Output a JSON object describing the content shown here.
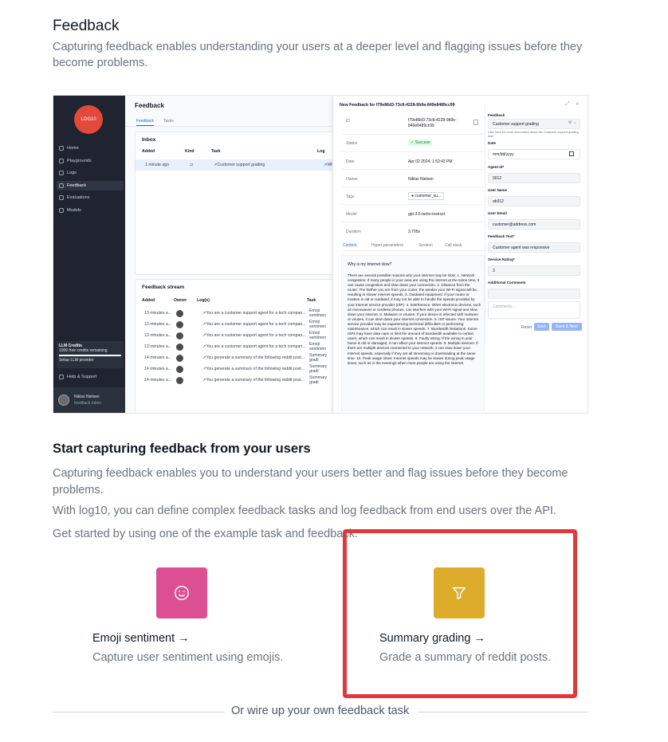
{
  "header": {
    "title": "Feedback",
    "subtitle": "Capturing feedback enables understanding your users at a deeper level and flagging issues before they become problems."
  },
  "preview": {
    "sidebar": {
      "logo_text": "LOG10",
      "items": [
        {
          "label": "Home",
          "active": false
        },
        {
          "label": "Playgrounds",
          "active": false
        },
        {
          "label": "Logs",
          "active": false
        },
        {
          "label": "Feedback",
          "active": true
        },
        {
          "label": "Evaluations",
          "active": false
        },
        {
          "label": "Models",
          "active": false
        }
      ],
      "credits_title": "LLM Credits",
      "credits_sub": "1000 free credits remaining",
      "credits_link": "Setup LLM provider",
      "help": "Help & Support",
      "user_name": "Niklas Nielsen",
      "user_org": "feedback-inbox"
    },
    "main": {
      "title": "Feedback",
      "tabs": [
        "Feedback",
        "Tasks"
      ],
      "inbox_title": "Inbox",
      "inbox_cols": [
        "Added",
        "Kind",
        "Task",
        "Log"
      ],
      "inbox_row": {
        "added": "1 minute ago",
        "task": "↗Customer support grading",
        "log": "↗Why"
      },
      "stream_title": "Feedback stream",
      "stream_cols": [
        "Added",
        "Owner",
        "Log(s)",
        "Task"
      ],
      "stream_rows": [
        {
          "added": "13 minutes a...",
          "log": "↗You are a customer support agent for a tech compan...",
          "task": "Emoji sentimen"
        },
        {
          "added": "13 minutes a...",
          "log": "↗You are a customer support agent for a tech compan...",
          "task": "Emoji sentimen"
        },
        {
          "added": "13 minutes a...",
          "log": "↗You are a customer support agent for a tech compan...",
          "task": "Emoji sentimen"
        },
        {
          "added": "13 minutes a...",
          "log": "↗You are a customer support agent for a tech compan...",
          "task": "Emoji sentimen"
        },
        {
          "added": "14 minutes a...",
          "log": "↗You generate a summary of the following reddit post...",
          "task": "Summary gradi"
        },
        {
          "added": "14 minutes a...",
          "log": "↗You generate a summary of the following reddit post...",
          "task": "Summary gradi"
        },
        {
          "added": "14 minutes a...",
          "log": "↗You generate a summary of the following reddit post...",
          "task": "Summary gradi"
        }
      ]
    },
    "panel": {
      "title": "New Feedback for f79e86d3-73c8-4228-9b9a-849e8489cc99",
      "fields": [
        {
          "k": "ID",
          "v": "f79e86d3-73c8-4228-9b9e-849e8489cc99"
        },
        {
          "k": "Status",
          "v": "✓ Success"
        },
        {
          "k": "Date",
          "v": "Apr 02 2024, 1:53:43 PM"
        },
        {
          "k": "Owner",
          "v": "Niklas Nielsen"
        },
        {
          "k": "Tags",
          "v": "● customer_su..."
        },
        {
          "k": "Model",
          "v": "gpt-3.5-turbo-instruct"
        },
        {
          "k": "Duration",
          "v": "3.705s"
        }
      ],
      "subtabs": [
        "Content",
        "Hyper parameters",
        "Session",
        "Call stack"
      ],
      "question": "Why is my internet slow?",
      "answer": "There are several possible reasons why your internet may be slow: 1. Network congestion: If many people in your area are using the internet at the same time, it can cause congestion and slow down your connection. 2. Distance from the router: The farther you are from your router, the weaker your Wi-Fi signal will be, resulting in slower internet speeds. 3. Outdated equipment: If your router or modem is old or outdated, it may not be able to handle the speeds provided by your internet service provider (ISP). 4. Interference: Other electronic devices, such as microwaves or cordless phones, can interfere with your Wi-Fi signal and slow down your internet. 5. Malware or viruses: If your device is infected with malware or viruses, it can slow down your internet connection. 6. ISP issues: Your internet service provider may be experiencing technical difficulties or performing maintenance, which can result in slower speeds. 7. Bandwidth limitations: Some ISPs may have data caps or limit the amount of bandwidth available to certain users, which can result in slower speeds. 8. Faulty wiring: If the wiring in your home is old or damaged, it can affect your internet speeds. 9. Multiple devices: If there are multiple devices connected to your network, it can slow down your internet speeds, especially if they are all streaming or downloading at the same time. 10. Peak usage times: Internet speeds may be slower during peak usage times, such as in the evenings when more people are using the internet.",
      "form": {
        "feedback_label": "Feedback",
        "feedback_value": "Customer support grading",
        "feedback_hint": "Click here for more information about the Customer support grading task",
        "date_label": "Date",
        "date_value": "mm/dd/yyyy",
        "agent_label": "Agent Id*",
        "agent_value": "0012",
        "user_label": "User Name",
        "user_value": "ab312",
        "email_label": "User Email",
        "email_value": "customer@address.com",
        "text_label": "Feedback Text*",
        "text_value": "Customer agent was responsive",
        "rating_label": "Service Rating*",
        "rating_value": "3",
        "comments_label": "Additional Comments",
        "comments_placeholder": "Comments...",
        "reset": "Reset",
        "save": "Save",
        "save_next": "Save & Next"
      }
    }
  },
  "section": {
    "title": "Start capturing feedback from your users",
    "p1": "Capturing feedback enables you to understand your users better and flag issues before they become problems.",
    "p2": "With log10, you can define complex feedback tasks and log feedback from end users over the API.",
    "p3": "Get started by using one of the example task and feedback."
  },
  "options": [
    {
      "title": "Emoji sentiment →",
      "desc": "Capture user sentiment using emojis.",
      "icon": "smile-icon",
      "color": "#dc4f93"
    },
    {
      "title": "Summary grading →",
      "desc": "Grade a summary of reddit posts.",
      "icon": "funnel-icon",
      "color": "#ddac2a"
    }
  ],
  "divider_text": "Or wire up your own feedback task",
  "colors": {
    "highlight": "#e0393a"
  }
}
